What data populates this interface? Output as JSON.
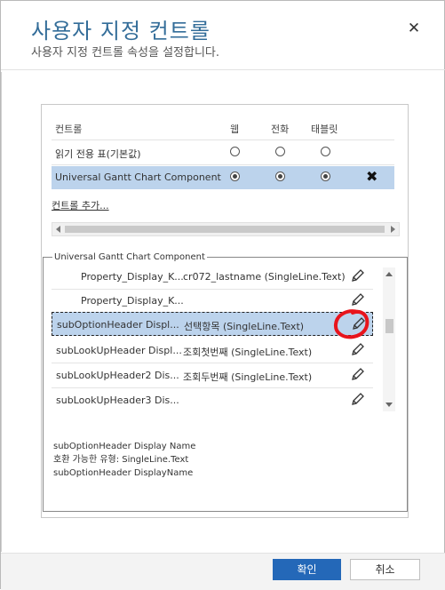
{
  "dialog": {
    "title": "사용자 지정 컨트롤",
    "subtitle": "사용자 지정 컨트롤 속성을 설정합니다.",
    "close_glyph": "✕"
  },
  "controls": {
    "headers": {
      "control": "컨트롤",
      "web": "웹",
      "phone": "전화",
      "tablet": "태블릿"
    },
    "rows": [
      {
        "label": "읽기 전용 표(기본값)",
        "web": false,
        "phone": false,
        "tablet": false,
        "selected": false
      },
      {
        "label": "Universal Gantt Chart Component",
        "web": true,
        "phone": true,
        "tablet": true,
        "selected": true,
        "remove_glyph": "✖"
      }
    ],
    "add_link": "컨트롤 추가..."
  },
  "properties": {
    "legend": "Universal Gantt Chart Component",
    "rows": [
      {
        "name": "Property_Display_K...",
        "value": "cr072_lastname (SingleLine.Text)",
        "indented": true,
        "selected": false
      },
      {
        "name": "Property_Display_K...",
        "value": "",
        "indented": true,
        "selected": false
      },
      {
        "name": "subOptionHeader Displ...",
        "value": "선택항목 (SingleLine.Text)",
        "indented": false,
        "selected": true
      },
      {
        "name": "subLookUpHeader Displ...",
        "value": "조회첫번째 (SingleLine.Text)",
        "indented": false,
        "selected": false
      },
      {
        "name": "subLookUpHeader2 Dis...",
        "value": "조회두번째 (SingleLine.Text)",
        "indented": false,
        "selected": false
      },
      {
        "name": "subLookUpHeader3 Dis...",
        "value": "",
        "indented": false,
        "selected": false
      }
    ],
    "edit_icon": "pencil-icon",
    "highlight_color": "#e8141c"
  },
  "description": {
    "line1": "subOptionHeader Display Name",
    "line2": "호환 가능한 유형: SingleLine.Text",
    "line3": "subOptionHeader DisplayName"
  },
  "footer": {
    "ok_label": "확인",
    "cancel_label": "취소"
  },
  "colors": {
    "accent": "#2468b8",
    "title": "#336d99",
    "selected_row": "#bcd3ec"
  }
}
